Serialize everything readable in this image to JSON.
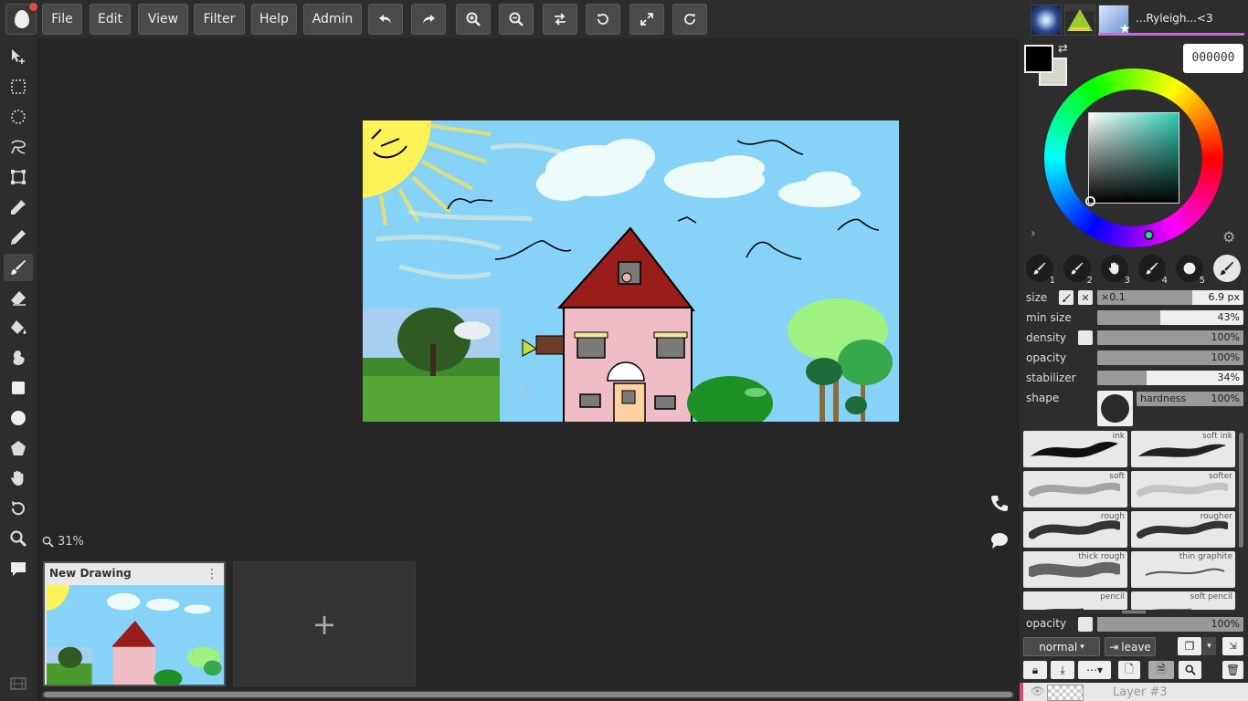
{
  "menu": {
    "file": "File",
    "edit": "Edit",
    "view": "View",
    "filter": "Filter",
    "help": "Help",
    "admin": "Admin"
  },
  "toolbar_icons": [
    "undo-icon",
    "redo-icon",
    "zoom-in-icon",
    "zoom-out-icon",
    "flip-icon",
    "rotate-ccw-icon",
    "fullscreen-icon",
    "rotate-cw-icon"
  ],
  "tools": [
    "move-icon",
    "rect-select-icon",
    "ellipse-select-icon",
    "lasso-icon",
    "transform-icon",
    "eyedropper-icon",
    "pen-icon",
    "brush-icon",
    "eraser-icon",
    "fill-icon",
    "smudge-icon",
    "rectangle-icon",
    "circle-icon",
    "shape-icon",
    "hand-icon",
    "undo-icon",
    "zoom-icon",
    "comment-icon"
  ],
  "canvas": {
    "zoom_label": "31%"
  },
  "tabs": {
    "doc_title": "New Drawing",
    "add_label": "+"
  },
  "user": {
    "name": "...Ryleigh...<3"
  },
  "color": {
    "primary": "#000000",
    "secondary": "#d7d4c8",
    "hex": "000000"
  },
  "brush_presets": [
    "1",
    "2",
    "3",
    "4",
    "5",
    "6"
  ],
  "brush_settings": {
    "size_label": "size",
    "size_prefix": "×0.1",
    "size_value": "6.9 px",
    "size_fill": 0.65,
    "min_size_label": "min size",
    "min_size_value": "43%",
    "min_size_fill": 0.43,
    "density_label": "density",
    "density_value": "100%",
    "opacity_label": "opacity",
    "opacity_value": "100%",
    "stabilizer_label": "stabilizer",
    "stabilizer_value": "34%",
    "stabilizer_fill": 0.34,
    "shape_label": "shape",
    "hardness_label": "hardness",
    "hardness_value": "100%"
  },
  "brushes": [
    "ink",
    "soft ink",
    "soft",
    "softer",
    "rough",
    "rougher",
    "thick rough",
    "thin graphite",
    "pencil",
    "soft pencil"
  ],
  "layers": {
    "opacity_label": "opacity",
    "opacity_value": "100%",
    "blend_mode": "normal",
    "leave_label": "leave",
    "layer_name": "Layer #3"
  }
}
